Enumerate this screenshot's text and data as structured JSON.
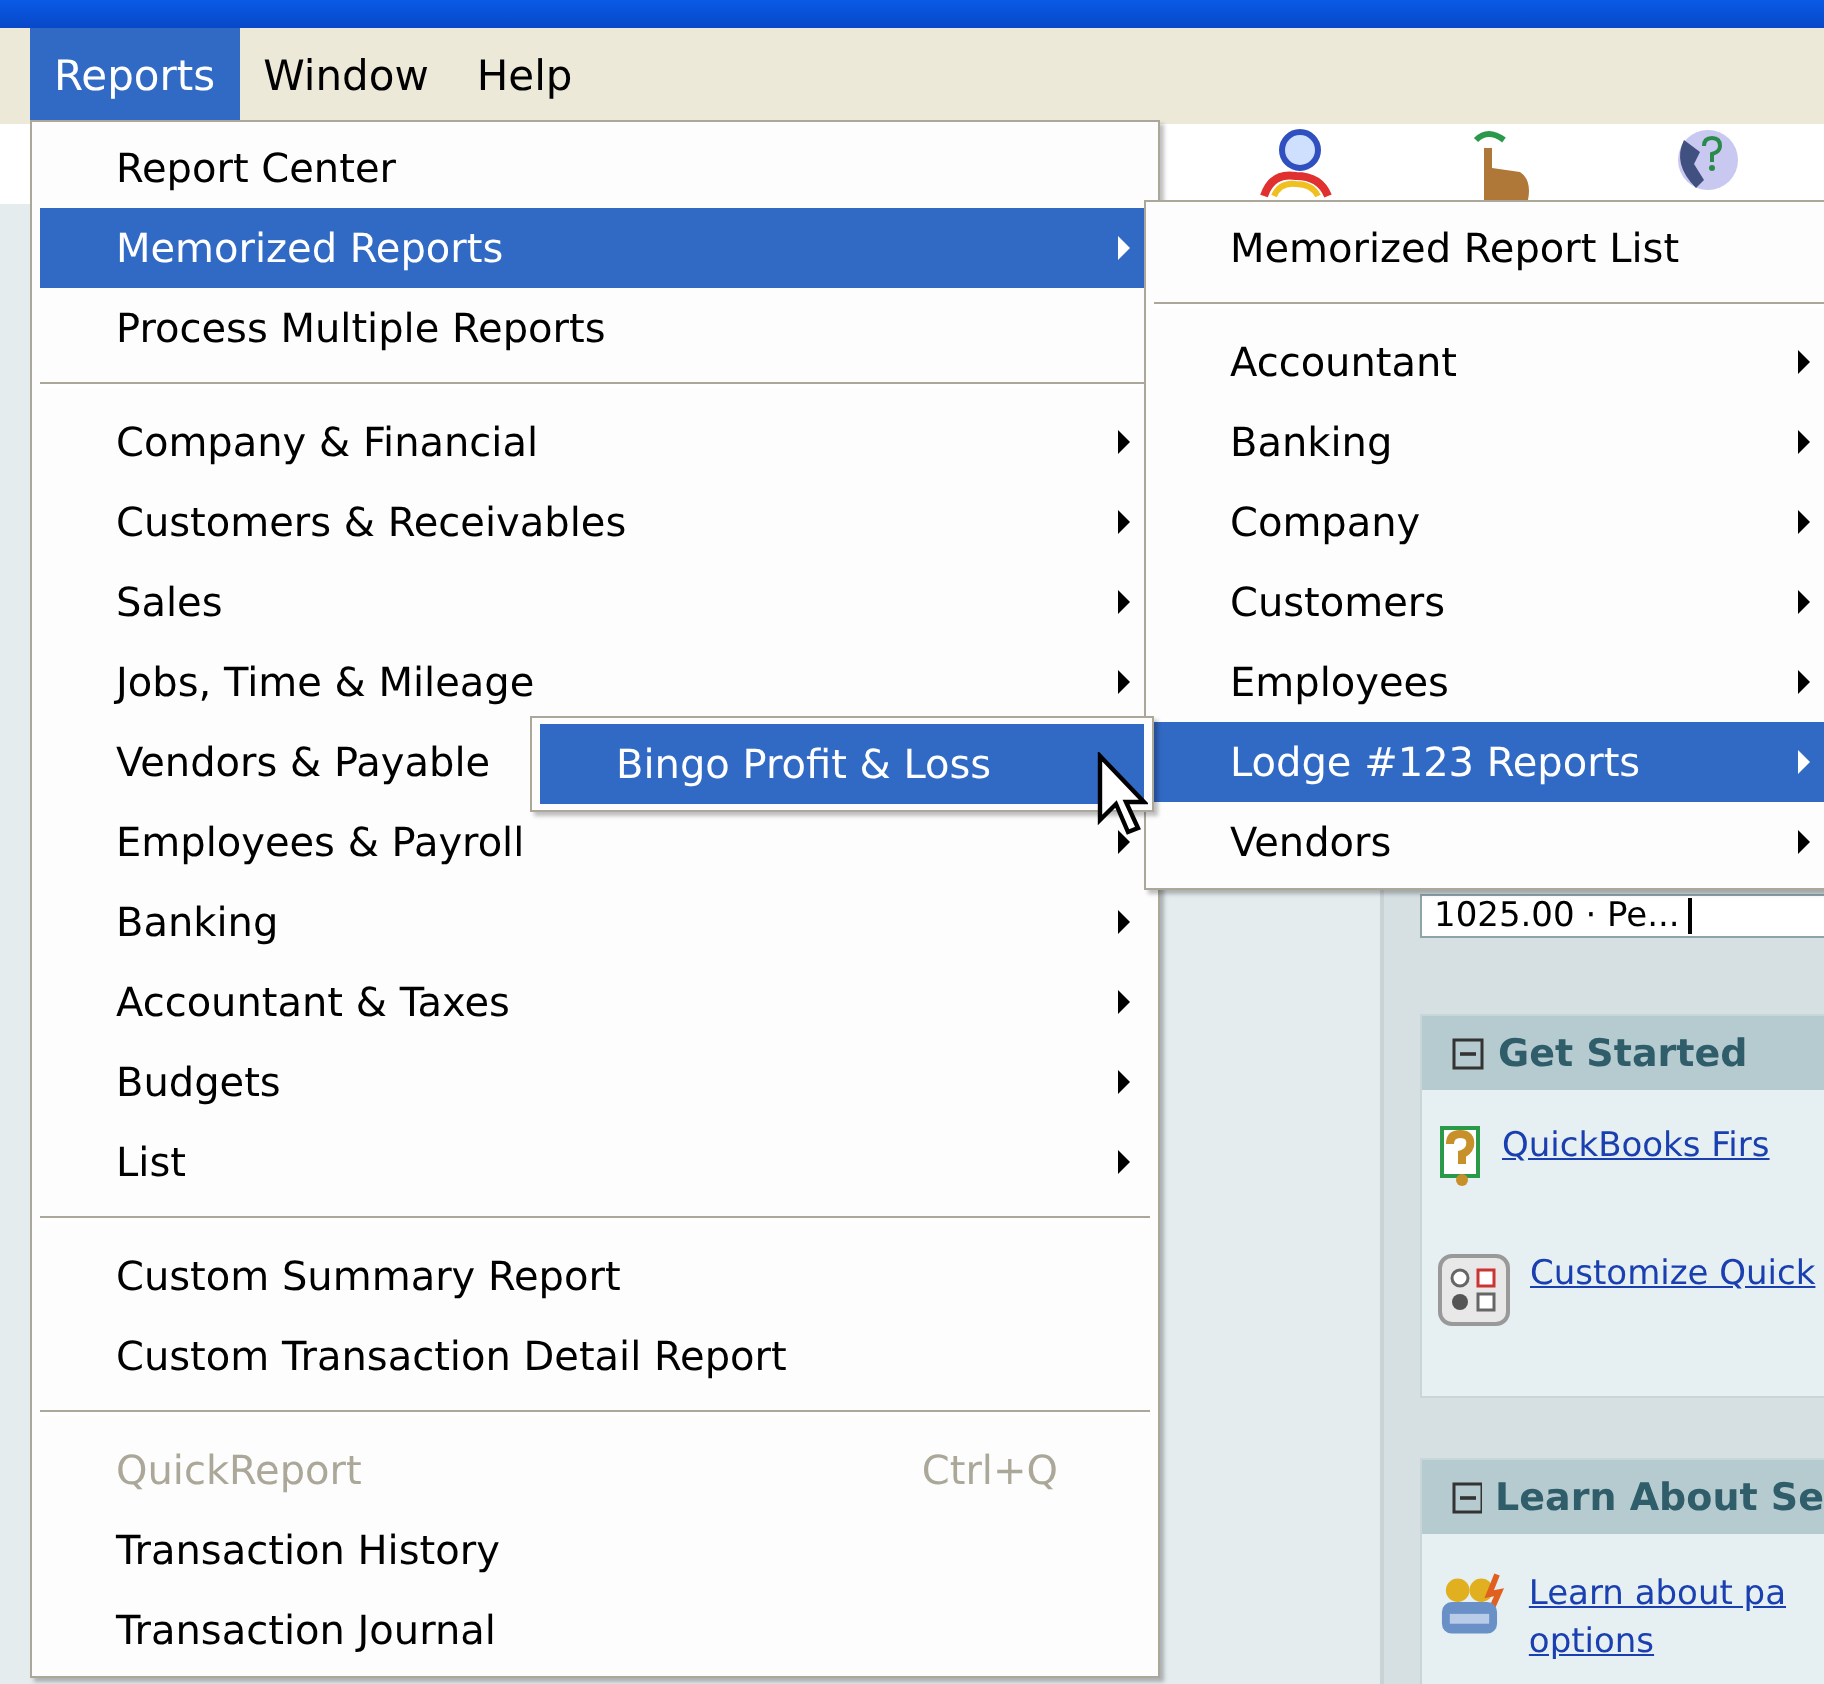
{
  "menu_bar": [
    {
      "label": "Reports",
      "selected": true
    },
    {
      "label": "Window",
      "selected": false
    },
    {
      "label": "Help",
      "selected": false
    }
  ],
  "menus": [
    {
      "items": [
        {
          "kind": "item",
          "label": "Report Center",
          "selected": false,
          "disabled": false,
          "submenu": false
        },
        {
          "kind": "item",
          "label": "Memorized Reports",
          "selected": true,
          "disabled": false,
          "submenu": true
        },
        {
          "kind": "item",
          "label": "Process Multiple Reports",
          "selected": false,
          "disabled": false,
          "submenu": false
        },
        {
          "kind": "separator"
        },
        {
          "kind": "item",
          "label": "Company & Financial",
          "selected": false,
          "disabled": false,
          "submenu": true
        },
        {
          "kind": "item",
          "label": "Customers & Receivables",
          "selected": false,
          "disabled": false,
          "submenu": true
        },
        {
          "kind": "item",
          "label": "Sales",
          "selected": false,
          "disabled": false,
          "submenu": true
        },
        {
          "kind": "item",
          "label": "Jobs, Time & Mileage",
          "selected": false,
          "disabled": false,
          "submenu": true
        },
        {
          "kind": "item",
          "label": "Vendors & Payable",
          "selected": false,
          "disabled": false
        },
        {
          "kind": "item",
          "label": "Employees & Payroll",
          "selected": false,
          "disabled": false,
          "submenu": true
        },
        {
          "kind": "item",
          "label": "Banking",
          "selected": false,
          "disabled": false,
          "submenu": true
        },
        {
          "kind": "item",
          "label": "Accountant & Taxes",
          "selected": false,
          "disabled": false,
          "submenu": true
        },
        {
          "kind": "item",
          "label": "Budgets",
          "selected": false,
          "disabled": false,
          "submenu": true
        },
        {
          "kind": "item",
          "label": "List",
          "selected": false,
          "disabled": false,
          "submenu": true
        },
        {
          "kind": "separator"
        },
        {
          "kind": "item",
          "label": "Custom Summary Report",
          "selected": false,
          "disabled": false,
          "submenu": false
        },
        {
          "kind": "item",
          "label": "Custom Transaction Detail Report",
          "selected": false,
          "disabled": false,
          "submenu": false
        },
        {
          "kind": "separator"
        },
        {
          "kind": "item",
          "label": "QuickReport",
          "shortcut": "Ctrl+Q",
          "selected": false,
          "disabled": true,
          "submenu": false
        },
        {
          "kind": "item",
          "label": "Transaction History",
          "selected": false,
          "disabled": false,
          "submenu": false
        },
        {
          "kind": "item",
          "label": "Transaction Journal",
          "selected": false,
          "disabled": false,
          "submenu": false
        }
      ]
    },
    {
      "items": [
        {
          "kind": "item",
          "label": "Memorized Report List",
          "selected": false,
          "disabled": false,
          "submenu": false
        },
        {
          "kind": "separator"
        },
        {
          "kind": "item",
          "label": "Accountant",
          "selected": false,
          "disabled": false,
          "submenu": true
        },
        {
          "kind": "item",
          "label": "Banking",
          "selected": false,
          "disabled": false,
          "submenu": true
        },
        {
          "kind": "item",
          "label": "Company",
          "selected": false,
          "disabled": false,
          "submenu": true
        },
        {
          "kind": "item",
          "label": "Customers",
          "selected": false,
          "disabled": false,
          "submenu": true
        },
        {
          "kind": "item",
          "label": "Employees",
          "selected": false,
          "disabled": false,
          "submenu": true
        },
        {
          "kind": "item",
          "label": "Lodge #123 Reports",
          "selected": true,
          "disabled": false,
          "submenu": true
        },
        {
          "kind": "item",
          "label": "Vendors",
          "selected": false,
          "disabled": false,
          "submenu": true
        }
      ]
    },
    {
      "items": [
        {
          "kind": "item",
          "label": "Bingo Profit & Loss",
          "selected": true,
          "disabled": false,
          "submenu": false
        }
      ]
    }
  ],
  "account_field": {
    "value": "1025.00 · Pe..."
  },
  "panels": [
    {
      "title": "Get Started",
      "expanded": true,
      "links": [
        "QuickBooks Firs",
        "Customize Quick"
      ]
    },
    {
      "title": "Learn About Se",
      "expanded": true,
      "links": [
        "Learn about pa options"
      ]
    }
  ]
}
